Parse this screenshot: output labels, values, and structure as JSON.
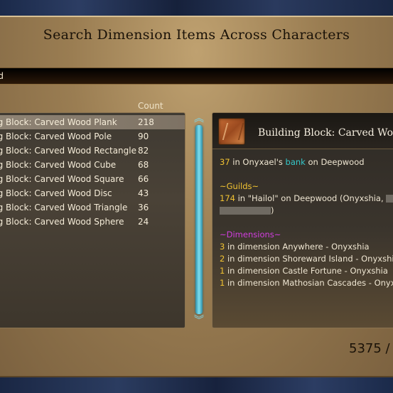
{
  "window": {
    "title": "Search Dimension Items Across Characters"
  },
  "search": {
    "value": "od"
  },
  "list": {
    "count_header": "Count",
    "rows": [
      {
        "name": "ng Block: Carved Wood Plank",
        "count": "218",
        "selected": true
      },
      {
        "name": "ng Block: Carved Wood Pole",
        "count": "90"
      },
      {
        "name": "ng Block: Carved Wood Rectangle",
        "count": "82"
      },
      {
        "name": "ng Block: Carved Wood Cube",
        "count": "68"
      },
      {
        "name": "ng Block: Carved Wood Square",
        "count": "66"
      },
      {
        "name": "ng Block: Carved Wood Disc",
        "count": "43"
      },
      {
        "name": "ng Block: Carved Wood Triangle",
        "count": "36"
      },
      {
        "name": "ng Block: Carved Wood Sphere",
        "count": "24"
      }
    ]
  },
  "detail": {
    "item_name": "Building Block: Carved Woo",
    "icon": "carved-wood-block-icon",
    "bank_line": {
      "count": "37",
      "prefix": " in Onyxael's ",
      "bank": "bank",
      "suffix": " on Deepwood"
    },
    "guilds_header": "~Guilds~",
    "guild_line": {
      "count": "174",
      "text": " in \"Hailol\" on Deepwood (Onyxshia, ",
      "close": ")"
    },
    "dimensions_header": "~Dimensions~",
    "dimensions": [
      {
        "count": "3",
        "text": " in dimension Anywhere - Onyxshia"
      },
      {
        "count": "2",
        "text": " in dimension Shoreward Island - Onyxshia"
      },
      {
        "count": "1",
        "text": " in dimension Castle Fortune - Onyxshia"
      },
      {
        "count": "1",
        "text": " in dimension Mathosian Cascades - Onyxshia"
      }
    ]
  },
  "footer": {
    "total": "5375 /"
  },
  "colors": {
    "accent_gold": "#f1c232",
    "bank_teal": "#35c7c9",
    "dimension_magenta": "#d23ee0",
    "guild_gold": "#f1c232"
  }
}
